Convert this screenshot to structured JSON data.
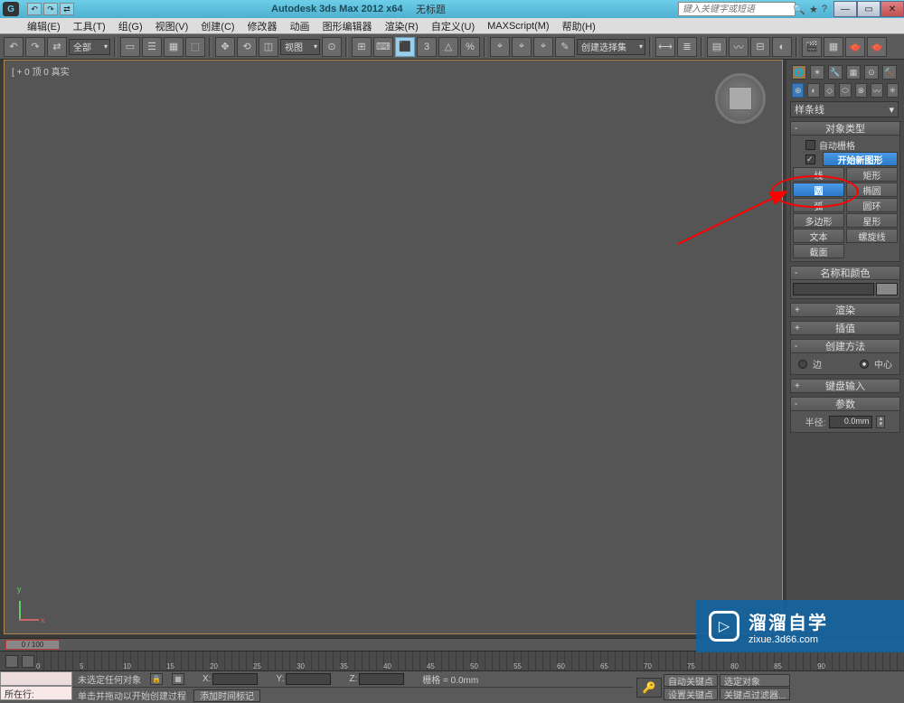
{
  "title": "Autodesk 3ds Max 2012 x64",
  "document": "无标题",
  "search_placeholder": "键入关键字或短语",
  "menu": [
    "编辑(E)",
    "工具(T)",
    "组(G)",
    "视图(V)",
    "创建(C)",
    "修改器",
    "动画",
    "图形编辑器",
    "渲染(R)",
    "自定义(U)",
    "MAXScript(M)",
    "帮助(H)"
  ],
  "toolbar": {
    "layer_dd": "全部",
    "view_dd": "视图",
    "selset_dd": "创建选择集"
  },
  "viewport_label": "[ + 0 顶 0 真实",
  "axis": {
    "x": "x",
    "y": "y"
  },
  "cmd": {
    "category": "样条线",
    "rollouts": {
      "obj_type": "对象类型",
      "autogrid": "自动栅格",
      "start_new": "开始新图形",
      "name_color": "名称和颜色",
      "render": "渲染",
      "interp": "插值",
      "create_method": "创建方法",
      "kb_entry": "键盘输入",
      "params": "参数"
    },
    "buttons": {
      "line": "线",
      "rect": "矩形",
      "circle": "圆",
      "ellipse": "椭圆",
      "arc": "弧",
      "donut": "圆环",
      "ngon": "多边形",
      "star": "星形",
      "text": "文本",
      "helix": "螺旋线",
      "section": "截面"
    },
    "method": {
      "edge": "边",
      "center": "中心"
    },
    "radius_label": "半径:",
    "radius_val": "0.0mm"
  },
  "timeline": {
    "range": "0 / 100",
    "ticks": [
      "0",
      "5",
      "10",
      "15",
      "20",
      "25",
      "30",
      "35",
      "40",
      "45",
      "50",
      "55",
      "60",
      "65",
      "70",
      "75",
      "80",
      "85",
      "90"
    ]
  },
  "status": {
    "row_label": "所在行:",
    "no_sel": "未选定任何对象",
    "prompt": "单击并拖动以开始创建过程",
    "add_time": "添加时间标记",
    "grid": "栅格 = 0.0mm",
    "coords": {
      "x": "X:",
      "y": "Y:",
      "z": "Z:"
    },
    "auto_key": "自动关键点",
    "set_key": "设置关键点",
    "sel_filter": "选定对象",
    "key_filter": "关键点过滤器..."
  },
  "watermark": {
    "brand": "溜溜自学",
    "url": "zixue.3d66.com"
  }
}
